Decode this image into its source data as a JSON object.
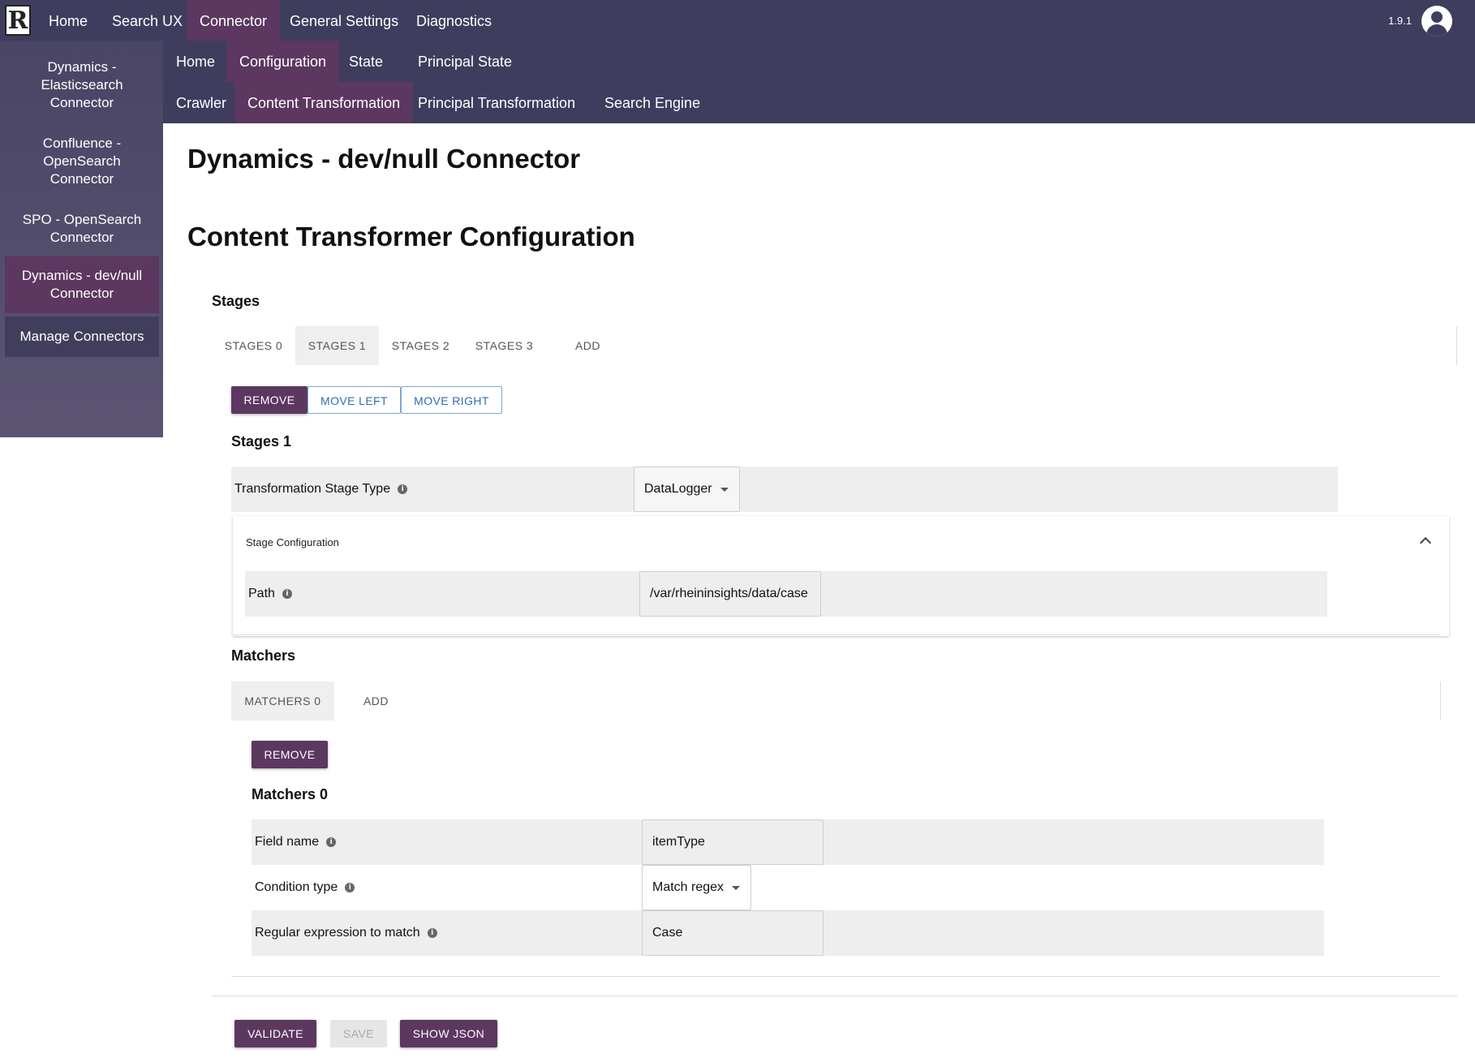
{
  "top_nav": {
    "logo": "R",
    "items": [
      "Home",
      "Search UX",
      "Connector",
      "General Settings",
      "Diagnostics"
    ],
    "version": "1.9.1"
  },
  "sub_nav": {
    "row1": [
      "Home",
      "Configuration",
      "State",
      "Principal State"
    ],
    "row2": [
      "Crawler",
      "Content Transformation",
      "Principal Transformation",
      "Search Engine"
    ]
  },
  "sidebar": {
    "items": [
      "Dynamics - Elasticsearch Connector",
      "Confluence - OpenSearch Connector",
      "SPO - OpenSearch Connector",
      "Dynamics - dev/null Connector",
      "Manage Connectors"
    ]
  },
  "main": {
    "page_title": "Dynamics - dev/null Connector",
    "section_title": "Content Transformer Configuration",
    "stages": {
      "heading": "Stages",
      "tabs": [
        "STAGES 0",
        "STAGES 1",
        "STAGES 2",
        "STAGES 3",
        "ADD"
      ],
      "buttons": {
        "remove": "REMOVE",
        "move_left": "MOVE LEFT",
        "move_right": "MOVE RIGHT"
      },
      "current_heading": "Stages 1",
      "stage_type_label": "Transformation Stage Type",
      "stage_type_value": "DataLogger",
      "stage_config_title": "Stage Configuration",
      "path_label": "Path",
      "path_value": "/var/rheininsights/data/case"
    },
    "matchers": {
      "heading": "Matchers",
      "tabs": [
        "MATCHERS 0",
        "ADD"
      ],
      "remove": "REMOVE",
      "current_heading": "Matchers 0",
      "field_name_label": "Field name",
      "field_name_value": "itemType",
      "condition_type_label": "Condition type",
      "condition_type_value": "Match regex",
      "regex_label": "Regular expression to match",
      "regex_value": "Case"
    },
    "footer_buttons": {
      "validate": "VALIDATE",
      "save": "SAVE",
      "show_json": "SHOW JSON"
    }
  },
  "icons": {
    "info": "info-icon",
    "caret": "caret-down-icon",
    "collapse": "chevron-up-icon",
    "account": "account-icon"
  },
  "colors": {
    "nav_bg": "#3f3d5e",
    "accent": "#5c3760",
    "outline_blue": "#2f6eb3"
  }
}
